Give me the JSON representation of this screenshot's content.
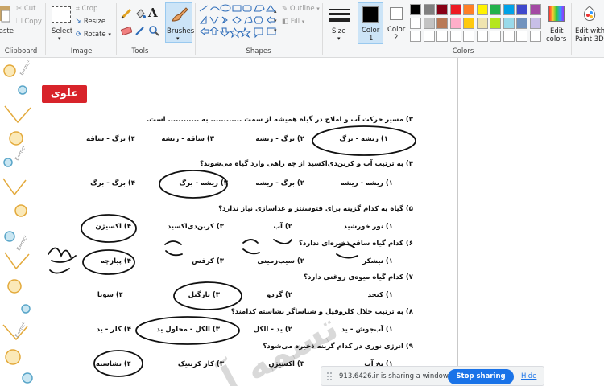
{
  "ribbon": {
    "clipboard": {
      "paste_label": "Paste",
      "cut_label": "Cut",
      "copy_label": "Copy",
      "group_label": "Clipboard"
    },
    "image": {
      "select_label": "Select",
      "crop_label": "Crop",
      "resize_label": "Resize",
      "rotate_label": "Rotate",
      "group_label": "Image"
    },
    "tools": {
      "group_label": "Tools"
    },
    "brushes": {
      "label": "Brushes"
    },
    "shapes": {
      "outline_label": "Outline",
      "fill_label": "Fill",
      "group_label": "Shapes"
    },
    "size": {
      "label": "Size"
    },
    "color1": {
      "label_line1": "Color",
      "label_line2": "1"
    },
    "color2": {
      "label_line1": "Color",
      "label_line2": "2"
    },
    "colors": {
      "group_label": "Colors",
      "palette_row1": [
        "#000000",
        "#7f7f7f",
        "#880015",
        "#ed1c24",
        "#ff7f27",
        "#fff200",
        "#22b14c",
        "#00a2e8",
        "#3f48cc",
        "#a349a4"
      ],
      "palette_row2": [
        "#ffffff",
        "#c3c3c3",
        "#b97a57",
        "#ffaec9",
        "#ffc90e",
        "#efe4b0",
        "#b5e61d",
        "#99d9ea",
        "#7092be",
        "#c8bfe7"
      ]
    },
    "edit_colors": {
      "label_line1": "Edit",
      "label_line2": "colors"
    },
    "paint3d": {
      "label_line1": "Edit with",
      "label_line2": "Paint 3D"
    }
  },
  "worksheet": {
    "badge": "علوی",
    "q3a": {
      "text": "۳) مسیر حرکت آب و املاح در گیاه همیشه از سمت ............ به ............ است."
    },
    "q3a_opts": [
      "۱) ریشه - برگ",
      "۲) برگ - ریشه",
      "۳) ساقه - ریشه",
      "۴) برگ - ساقه"
    ],
    "q4": {
      "text": "۴) به ترتیب آب و کربن‌دی‌اکسید از چه راهی وارد گیاه می‌شوند؟"
    },
    "q4_opts": [
      "۱) ریشه - ریشه",
      "۲) برگ - ریشه",
      "۳) ریشه - برگ",
      "۴) برگ - برگ"
    ],
    "q5": {
      "text": "۵) گیاه به کدام گزینه برای فتوسنتز و غذاسازی نیاز ندارد؟"
    },
    "q5_opts": [
      "۱) نور خورشید",
      "۲) آب",
      "۳) کربن‌دی‌اکسید",
      "۴) اکسیژن"
    ],
    "q6": {
      "text": "۶) کدام گیاه ساقه ذخیره‌ای ندارد؟"
    },
    "q6_opts": [
      "۱) نیشکر",
      "۲) سیب‌زمینی",
      "۳) کرفس",
      "۴) پیازچه"
    ],
    "q7": {
      "text": "۷) کدام گیاه میوه‌ی روغنی دارد؟"
    },
    "q7_opts": [
      "۱) کنجد",
      "۲) گردو",
      "۳) نارگیل",
      "۴) سویا"
    ],
    "q8": {
      "text": "۸) به ترتیب حلال کلروفیل و شناساگر نشاسته کدامند؟"
    },
    "q8_opts": [
      "۱) آب‌جوش - ید",
      "۲) ید - الکل",
      "۳) الکل - محلول ید",
      "۴) کلر - ید"
    ],
    "q9": {
      "text": "۹) انرژی نوری در کدام گزینه ذخیره می‌شود؟"
    },
    "q9_opts": [
      "۱) نخ آب",
      "۳) اکسیژن",
      "۳) کاز کربنیک",
      "۴) نشاسته"
    ],
    "watermark": "تسمه آ"
  },
  "sharebar": {
    "message": "913.6426.ir is sharing a window.",
    "stop_label": "Stop sharing",
    "hide_label": "Hide"
  }
}
